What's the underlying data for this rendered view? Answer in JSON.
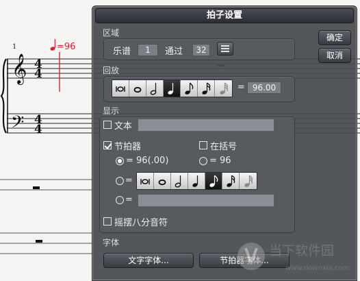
{
  "score": {
    "measure_number": "1",
    "tempo_equals": "=96",
    "time_signature_top": "4",
    "time_signature_bottom": "4"
  },
  "dialog": {
    "title": "拍子设置",
    "ok_label": "确定",
    "cancel_label": "取消",
    "region": {
      "section_label": "区域",
      "score_label": "乐谱",
      "score_value": "1",
      "through_label": "通过",
      "through_value": "32"
    },
    "playback": {
      "section_label": "回放",
      "notes": [
        "breve",
        "whole",
        "half",
        "quarter",
        "eighth",
        "sixteenth",
        "thirty-second"
      ],
      "selected_note": "quarter",
      "equals": "=",
      "tempo_value": "96.00"
    },
    "display": {
      "section_label": "显示",
      "text_label": "文本",
      "text_checked": false,
      "metronome_label": "节拍器",
      "metronome_checked": true,
      "parentheses_label": "在括号",
      "parentheses_checked": false,
      "option1_label": "= 96(.00)",
      "option1_checked": true,
      "option2_label": "= 96",
      "option2_checked": false,
      "option3_label": "=",
      "option3_selected_note": "eighth",
      "option4_label": "=",
      "swing_label": "摇摆八分音符",
      "swing_checked": false
    },
    "font": {
      "section_label": "字体",
      "text_font_button": "文字字体...",
      "metronome_font_button": "节拍器字体..."
    }
  },
  "watermark": {
    "brand": "当下软件园",
    "url": "www.downxia.com"
  },
  "colors": {
    "tempo_red": "#e0202a",
    "dialog_bg": "#464a50",
    "selected_note_bg": "#111111"
  }
}
